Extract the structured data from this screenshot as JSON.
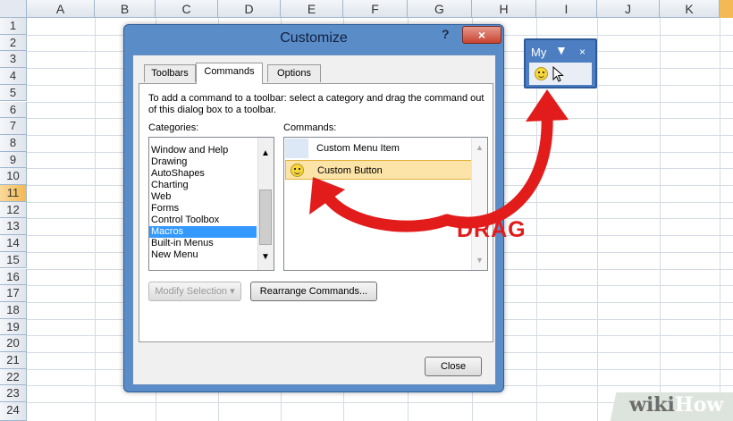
{
  "sheet": {
    "columns": [
      "A",
      "B",
      "C",
      "D",
      "E",
      "F",
      "G",
      "H",
      "I",
      "J",
      "K"
    ],
    "rows": [
      "1",
      "2",
      "3",
      "4",
      "5",
      "6",
      "7",
      "8",
      "9",
      "10",
      "11",
      "12",
      "13",
      "14",
      "15",
      "16",
      "17",
      "18",
      "19",
      "20",
      "21",
      "22",
      "23",
      "24"
    ],
    "selected_row": "11"
  },
  "dialog": {
    "title": "Customize",
    "help_glyph": "?",
    "close_glyph": "×",
    "tabs": [
      {
        "label": "Toolbars"
      },
      {
        "label": "Commands"
      },
      {
        "label": "Options"
      }
    ],
    "instruction": "To add a command to a toolbar: select a category and drag the command out of this dialog box to a toolbar.",
    "categories_label": "Categories:",
    "commands_label": "Commands:",
    "categories": [
      "Window and Help",
      "Drawing",
      "AutoShapes",
      "Charting",
      "Web",
      "Forms",
      "Control Toolbox",
      "Macros",
      "Built-in Menus",
      "New Menu"
    ],
    "selected_category": "Macros",
    "commands": [
      {
        "label": "Custom Menu Item",
        "icon": "blank-icon"
      },
      {
        "label": "Custom Button",
        "icon": "smiley-icon"
      }
    ],
    "modify_selection_label": "Modify Selection ▾",
    "rearrange_label": "Rearrange Commands...",
    "close_label": "Close"
  },
  "toolbar": {
    "title": "My",
    "dropdown_glyph": "▼",
    "close_glyph": "×"
  },
  "annotation": {
    "drag_label": "DRAG",
    "arrow_color": "#e21b1b"
  },
  "watermark": {
    "part1": "wiki",
    "part2": "How"
  }
}
